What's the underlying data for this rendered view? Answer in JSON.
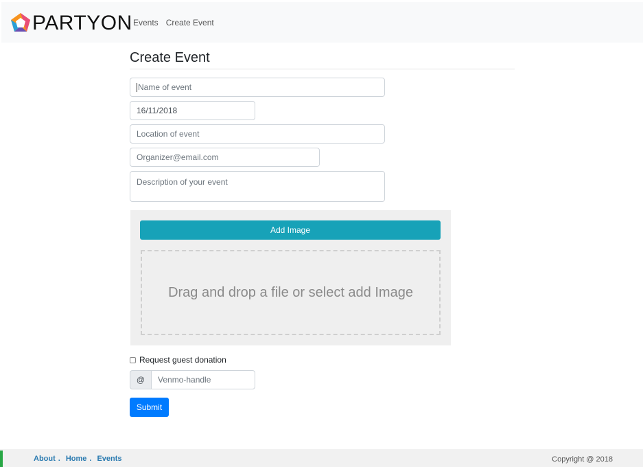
{
  "navbar": {
    "brand": "PARTYON",
    "links": [
      "Events",
      "Create Event"
    ]
  },
  "page": {
    "title": "Create Event"
  },
  "form": {
    "name_placeholder": "Name of event",
    "date_value": "16/11/2018",
    "location_placeholder": "Location of event",
    "email_placeholder": "Organizer@email.com",
    "description_placeholder": "Description of your event",
    "add_image_label": "Add Image",
    "dropzone_text": "Drag and drop a file or select add Image",
    "donation_label": "Request guest donation",
    "venmo_addon": "@",
    "venmo_placeholder": "Venmo-handle",
    "submit_label": "Submit"
  },
  "footer": {
    "links": [
      "About",
      "Home",
      "Events"
    ],
    "separator": ".",
    "copyright": "Copyright @ 2018"
  },
  "colors": {
    "info": "#17a2b8",
    "primary": "#007bff",
    "footer_link": "#2a7ab0",
    "footer_accent": "#28a745"
  }
}
